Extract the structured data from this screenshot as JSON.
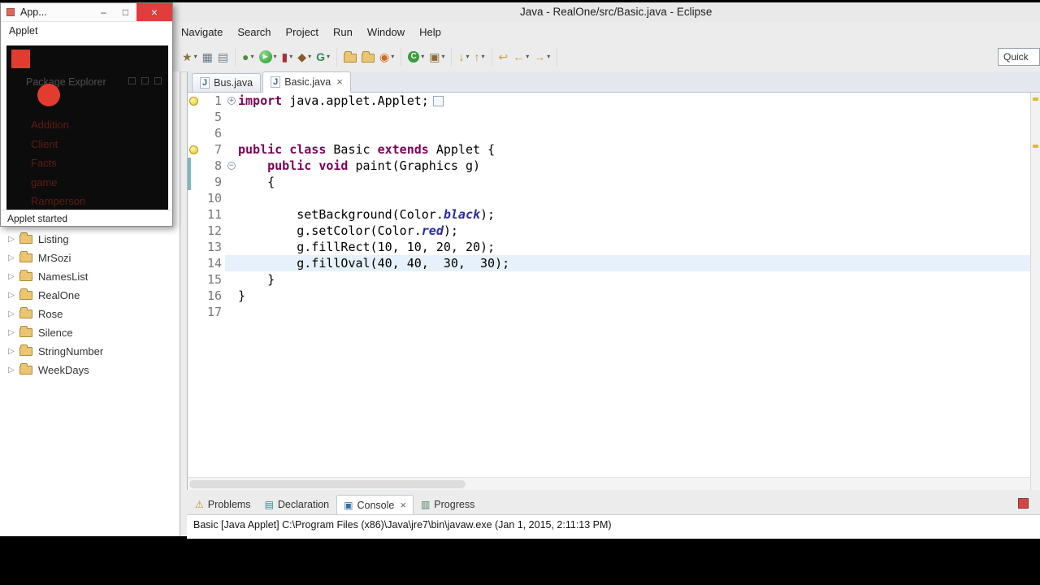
{
  "titlebar": {
    "title": "Java - RealOne/src/Basic.java - Eclipse"
  },
  "menubar": {
    "items": [
      "Navigate",
      "Search",
      "Project",
      "Run",
      "Window",
      "Help"
    ]
  },
  "toolbar": {
    "quick_access": "Quick",
    "groups": [
      [
        {
          "name": "new-wizard-icon",
          "kind": "glyph",
          "glyph": "★",
          "color": "#8a7340",
          "dropdown": true
        },
        {
          "name": "save-icon",
          "kind": "glyph",
          "glyph": "▦",
          "color": "#66778a"
        },
        {
          "name": "print-icon",
          "kind": "glyph",
          "glyph": "▤",
          "color": "#76808c"
        }
      ],
      [
        {
          "name": "debug-icon",
          "kind": "glyph",
          "glyph": "●",
          "color": "#4a8f3f",
          "dropdown": true
        },
        {
          "name": "run-icon",
          "kind": "run",
          "dropdown": true
        },
        {
          "name": "coverage-icon",
          "kind": "glyph",
          "glyph": "▮",
          "color": "#a83232",
          "dropdown": true
        },
        {
          "name": "external-tools-icon",
          "kind": "glyph",
          "glyph": "◆",
          "color": "#8a5a2a",
          "dropdown": true
        },
        {
          "name": "glassfish-icon",
          "kind": "glyph",
          "glyph": "G",
          "color": "#2e8b57",
          "dropdown": true
        }
      ],
      [
        {
          "name": "open-folder-icon",
          "kind": "folder"
        },
        {
          "name": "web-folder-icon",
          "kind": "folder"
        },
        {
          "name": "search-icon",
          "kind": "glyph",
          "glyph": "◉",
          "color": "#d2691e",
          "dropdown": true
        }
      ],
      [
        {
          "name": "new-java-class-icon",
          "kind": "class",
          "dropdown": true
        },
        {
          "name": "new-java-package-icon",
          "kind": "glyph",
          "glyph": "▣",
          "color": "#8b6b3d",
          "dropdown": true
        }
      ],
      [
        {
          "name": "next-annotation-icon",
          "kind": "glyph",
          "glyph": "↓",
          "color": "#b8a000",
          "dropdown": true
        },
        {
          "name": "prev-annotation-icon",
          "kind": "glyph",
          "glyph": "↑",
          "color": "#b8a000",
          "dropdown": true
        }
      ],
      [
        {
          "name": "last-edit-location-icon",
          "kind": "glyph",
          "glyph": "↩",
          "color": "#caa53d"
        },
        {
          "name": "back-icon",
          "kind": "glyph",
          "glyph": "←",
          "color": "#caa53d",
          "dropdown": true
        },
        {
          "name": "forward-icon",
          "kind": "glyph",
          "glyph": "→",
          "color": "#caa53d",
          "dropdown": true
        }
      ]
    ]
  },
  "applet_window": {
    "title": "App...",
    "controls": {
      "minimize": "–",
      "maximize": "□",
      "close": "×"
    },
    "menu_label": "Applet",
    "status_text": "Applet started",
    "ghost_view_title": "Package Explorer",
    "ghost_items": [
      "Addition",
      "Client",
      "Facts",
      "game",
      "Ramperson"
    ]
  },
  "package_explorer": {
    "expander_glyph": "▷",
    "items": [
      "Listing",
      "MrSozi",
      "NamesList",
      "RealOne",
      "Rose",
      "Silence",
      "StringNumber",
      "WeekDays"
    ]
  },
  "editor": {
    "tabs": [
      {
        "label": "Bus.java",
        "active": false
      },
      {
        "label": "Basic.java",
        "active": true,
        "close_glyph": "×"
      }
    ],
    "colors": {
      "keyword": "#7f0055",
      "field": "#2a2aa5",
      "plain": "#000000",
      "line_number": "#787878",
      "current_line_bg": "#e7f1fb"
    },
    "lines": [
      {
        "num": "1",
        "marker": "bulb",
        "fold": "collapsed",
        "foldbox": true,
        "segments": [
          {
            "t": "kw",
            "s": "import"
          },
          {
            "t": "p",
            "s": " java.applet.Applet;"
          }
        ]
      },
      {
        "num": "5",
        "segments": []
      },
      {
        "num": "6",
        "segments": []
      },
      {
        "num": "7",
        "marker": "bulb",
        "segments": [
          {
            "t": "kw",
            "s": "public"
          },
          {
            "t": "p",
            "s": " "
          },
          {
            "t": "kw",
            "s": "class"
          },
          {
            "t": "p",
            "s": " Basic "
          },
          {
            "t": "kw",
            "s": "extends"
          },
          {
            "t": "p",
            "s": " Applet {"
          }
        ]
      },
      {
        "num": "8",
        "fold": "expanded",
        "range": true,
        "segments": [
          {
            "t": "p",
            "s": "    "
          },
          {
            "t": "kw",
            "s": "public"
          },
          {
            "t": "p",
            "s": " "
          },
          {
            "t": "kw",
            "s": "void"
          },
          {
            "t": "p",
            "s": " paint(Graphics g)"
          }
        ]
      },
      {
        "num": "9",
        "range": true,
        "segments": [
          {
            "t": "p",
            "s": "    {"
          }
        ]
      },
      {
        "num": "10",
        "segments": []
      },
      {
        "num": "11",
        "segments": [
          {
            "t": "p",
            "s": "        setBackground(Color."
          },
          {
            "t": "fld",
            "s": "black"
          },
          {
            "t": "p",
            "s": ");"
          }
        ]
      },
      {
        "num": "12",
        "segments": [
          {
            "t": "p",
            "s": "        g.setColor(Color."
          },
          {
            "t": "fld",
            "s": "red"
          },
          {
            "t": "p",
            "s": ");"
          }
        ]
      },
      {
        "num": "13",
        "segments": [
          {
            "t": "p",
            "s": "        g.fillRect(10, 10, 20, 20);"
          }
        ]
      },
      {
        "num": "14",
        "current": true,
        "segments": [
          {
            "t": "p",
            "s": "        g.fillOval(40, 40,  30,  30);"
          }
        ]
      },
      {
        "num": "15",
        "segments": [
          {
            "t": "p",
            "s": "    }"
          }
        ]
      },
      {
        "num": "16",
        "segments": [
          {
            "t": "p",
            "s": "}"
          }
        ]
      },
      {
        "num": "17",
        "segments": []
      }
    ]
  },
  "bottom_panel": {
    "tabs": [
      {
        "label": "Problems",
        "icon": "problems-icon",
        "glyph": "⚠",
        "color": "#b5932a",
        "active": false
      },
      {
        "label": "Declaration",
        "icon": "declaration-icon",
        "glyph": "▤",
        "color": "#2e8f8f",
        "active": false
      },
      {
        "label": "Console",
        "icon": "console-icon",
        "glyph": "▣",
        "color": "#3b6ea5",
        "active": true,
        "close_glyph": "×"
      },
      {
        "label": "Progress",
        "icon": "progress-icon",
        "glyph": "▥",
        "color": "#4f7d5f",
        "active": false
      }
    ],
    "console_label": "Basic [Java Applet] C:\\Program Files (x86)\\Java\\jre7\\bin\\javaw.exe (Jan 1, 2015, 2:11:13 PM)"
  }
}
